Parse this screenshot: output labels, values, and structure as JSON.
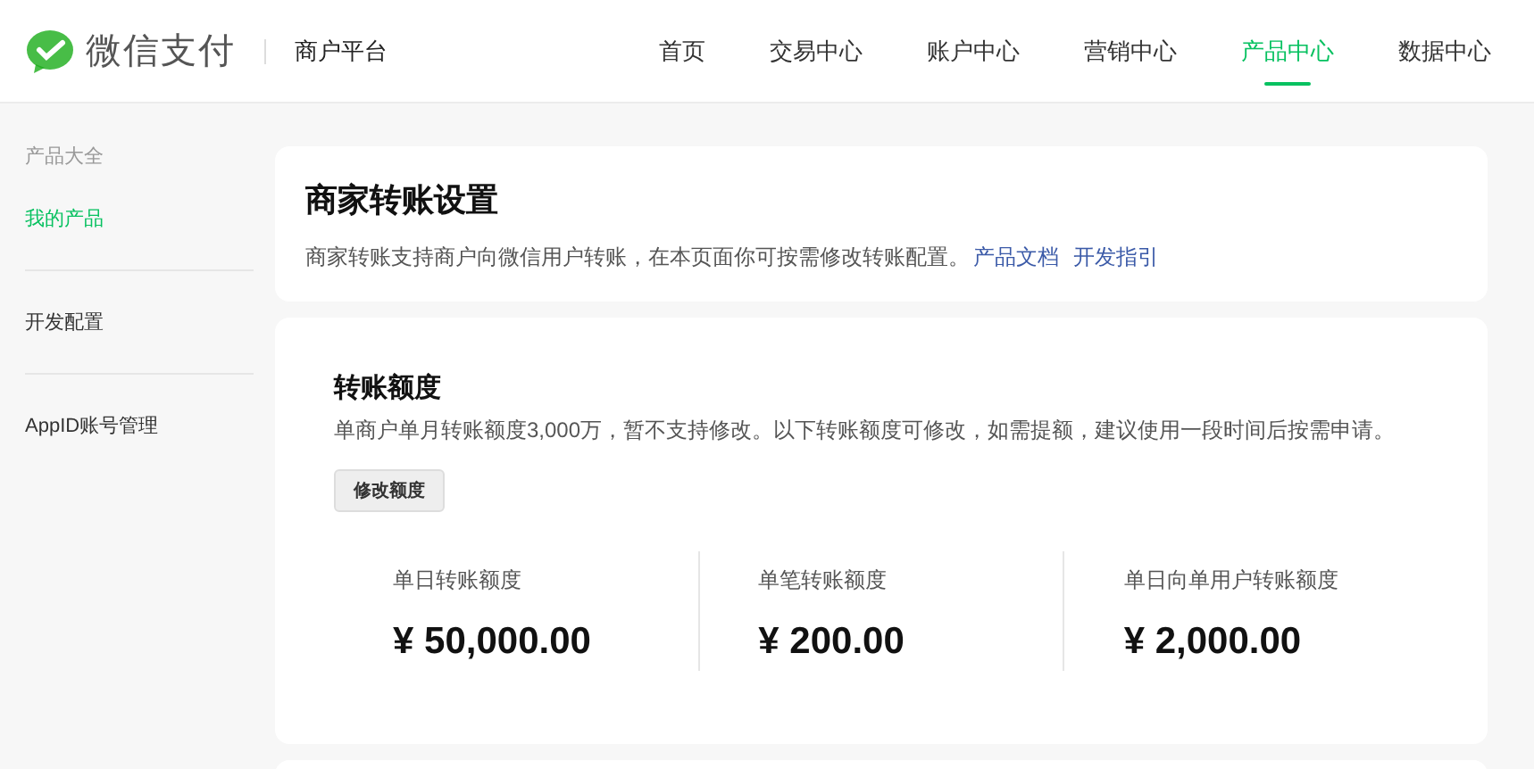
{
  "header": {
    "brand": "微信支付",
    "platform": "商户平台",
    "nav": [
      {
        "label": "首页",
        "selected": false
      },
      {
        "label": "交易中心",
        "selected": false
      },
      {
        "label": "账户中心",
        "selected": false
      },
      {
        "label": "营销中心",
        "selected": false
      },
      {
        "label": "产品中心",
        "selected": true
      },
      {
        "label": "数据中心",
        "selected": false
      }
    ]
  },
  "sidebar": {
    "items": [
      {
        "kind": "group",
        "label": "产品大全"
      },
      {
        "kind": "link",
        "label": "我的产品",
        "selected": true
      },
      {
        "kind": "link",
        "label": "开发配置",
        "selected": false
      },
      {
        "kind": "link",
        "label": "AppID账号管理",
        "selected": false
      }
    ]
  },
  "intro": {
    "title": "商家转账设置",
    "text": "商家转账支持商户向微信用户转账，在本页面你可按需修改转账配置。",
    "links": [
      "产品文档",
      "开发指引"
    ]
  },
  "quota": {
    "title": "转账额度",
    "text": "单商户单月转账额度3,000万，暂不支持修改。以下转账额度可修改，如需提额，建议使用一段时间后按需申请。",
    "button": "修改额度",
    "stats": [
      {
        "label": "单日转账额度",
        "value": "¥ 50,000.00"
      },
      {
        "label": "单笔转账额度",
        "value": "¥ 200.00"
      },
      {
        "label": "单日向单用户转账额度",
        "value": "¥ 2,000.00"
      }
    ]
  }
}
